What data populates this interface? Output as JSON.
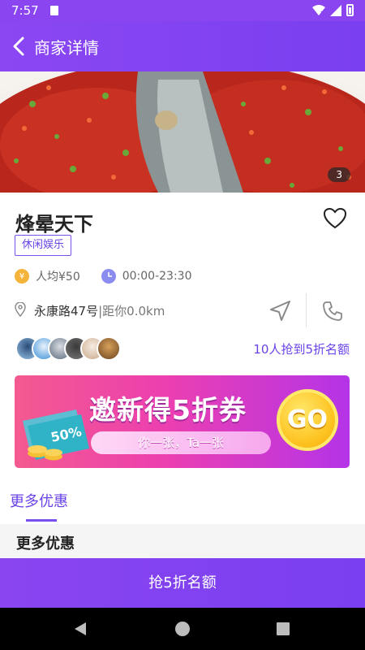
{
  "status_bar": {
    "time": "7:57"
  },
  "header": {
    "title": "商家详情"
  },
  "hero": {
    "photo_count": "3"
  },
  "shop": {
    "name": "烽晕天下",
    "tag": "休闲娱乐",
    "avg_price": "人均¥50",
    "hours": "00:00-23:30",
    "address": "永康路47号",
    "distance": "|距你0.0km",
    "coin_symbol": "¥"
  },
  "social": {
    "grab_count": "10人抢到5折名额"
  },
  "promo": {
    "title": "邀新得5折券",
    "subtitle": "你一张，Ta一张",
    "go_label": "GO",
    "ticket_text": "50%"
  },
  "tabs": {
    "active": "更多优惠"
  },
  "section": {
    "title": "更多优惠"
  },
  "cta": {
    "label": "抢5折名额"
  },
  "colors": {
    "primary": "#7a3ff0",
    "accent_text": "#6a43e8",
    "coin": "#f4b43a",
    "clock": "#8b8cf0"
  }
}
